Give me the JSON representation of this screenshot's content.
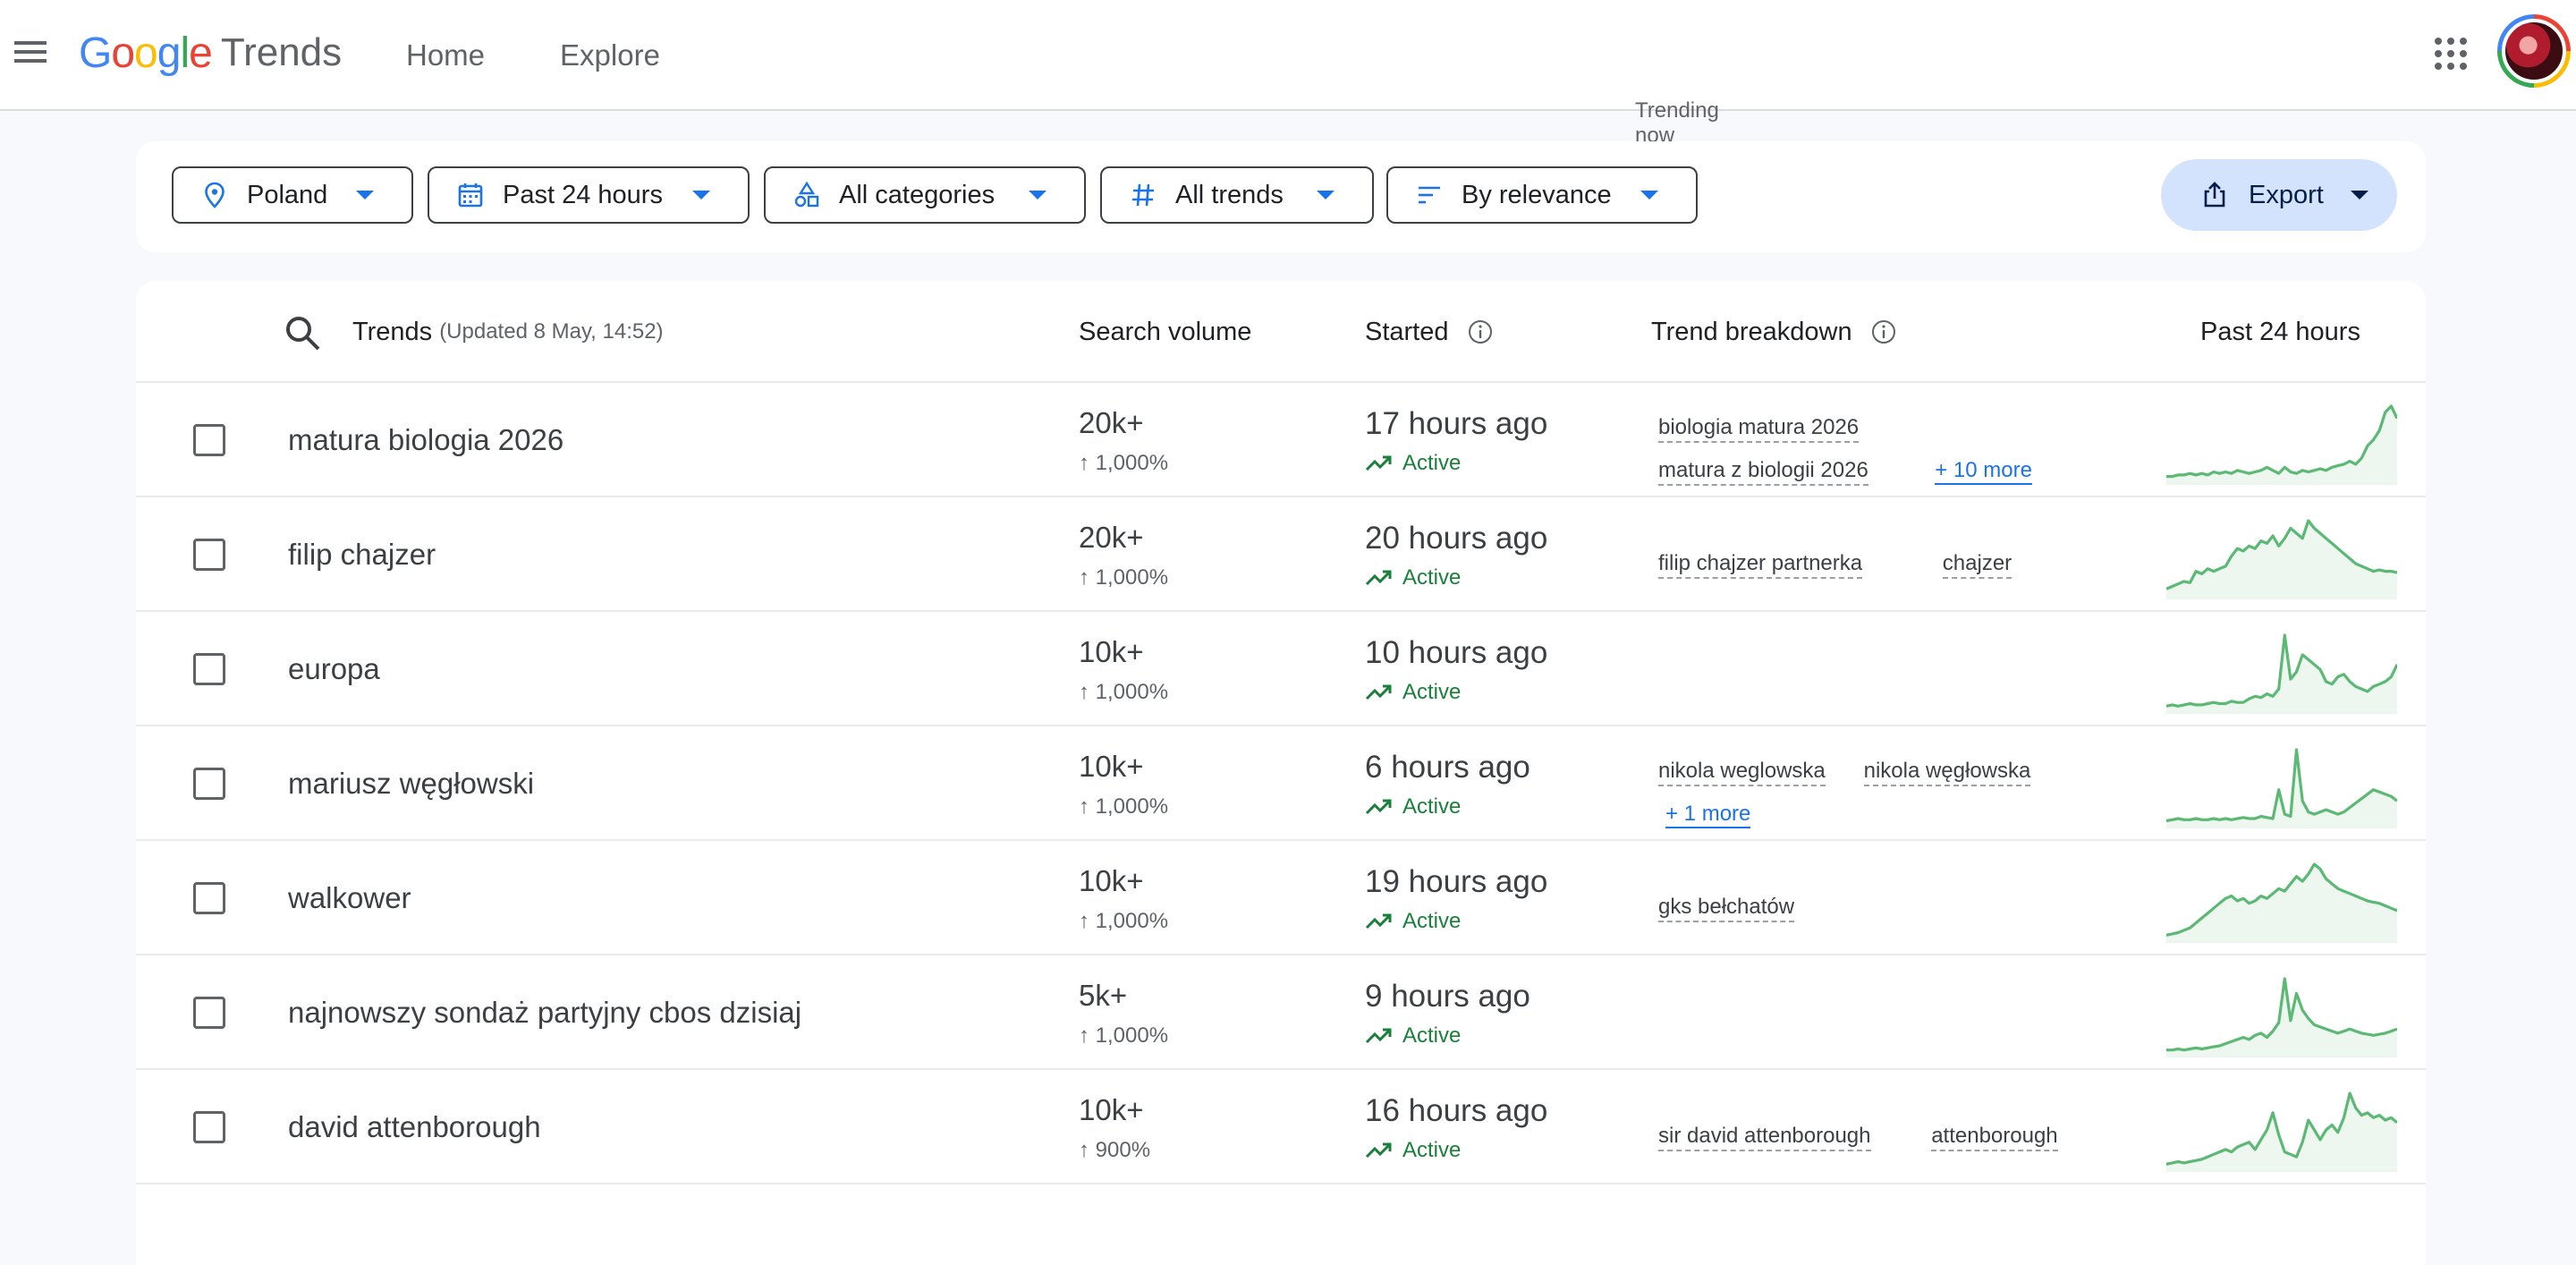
{
  "header": {
    "logo_google": "Google",
    "logo_trends": "Trends",
    "nav": [
      "Home",
      "Explore",
      "Trending now"
    ],
    "active_nav": "Trending now"
  },
  "filters": {
    "country": "Poland",
    "time": "Past 24 hours",
    "categories": "All categories",
    "trends": "All trends",
    "sort": "By relevance",
    "export": "Export"
  },
  "table": {
    "col_trends": "Trends",
    "updated": "(Updated 8 May, 14:52)",
    "col_volume": "Search volume",
    "col_started": "Started",
    "col_breakdown": "Trend breakdown",
    "col_past": "Past 24 hours",
    "rows": [
      {
        "term": "matura biologia 2026",
        "volume": "20k+",
        "change": "↑ 1,000%",
        "started": "17 hours ago",
        "status": "Active",
        "breakdown": [
          "biologia matura 2026",
          "matura z biologii 2026"
        ],
        "more": "+ 10 more",
        "spark": [
          2,
          2,
          3,
          3,
          4,
          3,
          4,
          3,
          5,
          4,
          5,
          4,
          6,
          5,
          4,
          5,
          6,
          8,
          6,
          4,
          8,
          5,
          4,
          6,
          5,
          6,
          7,
          6,
          8,
          9,
          10,
          12,
          10,
          14,
          22,
          26,
          32,
          44,
          48,
          40
        ]
      },
      {
        "term": "filip chajzer",
        "volume": "20k+",
        "change": "↑ 1,000%",
        "started": "20 hours ago",
        "status": "Active",
        "breakdown": [
          "filip chajzer partnerka",
          "chajzer"
        ],
        "more": "",
        "spark": [
          4,
          6,
          8,
          10,
          9,
          18,
          16,
          20,
          18,
          20,
          22,
          30,
          36,
          34,
          38,
          36,
          42,
          40,
          46,
          38,
          44,
          52,
          48,
          44,
          58,
          52,
          48,
          44,
          40,
          36,
          32,
          28,
          24,
          22,
          20,
          18,
          19,
          18,
          18,
          17
        ]
      },
      {
        "term": "europa",
        "volume": "10k+",
        "change": "↑ 1,000%",
        "started": "10 hours ago",
        "status": "Active",
        "breakdown": [],
        "more": "",
        "spark": [
          2,
          3,
          2,
          3,
          4,
          3,
          3,
          4,
          5,
          4,
          4,
          6,
          5,
          5,
          8,
          10,
          9,
          12,
          10,
          16,
          60,
          24,
          30,
          44,
          40,
          36,
          32,
          22,
          20,
          26,
          28,
          22,
          18,
          16,
          14,
          18,
          20,
          22,
          26,
          36
        ]
      },
      {
        "term": "mariusz węgłowski",
        "volume": "10k+",
        "change": "↑ 1,000%",
        "started": "6 hours ago",
        "status": "Active",
        "breakdown": [
          "nikola weglowska",
          "nikola węgłowska"
        ],
        "more": "+ 1 more",
        "spark": [
          2,
          3,
          4,
          3,
          3,
          4,
          3,
          3,
          4,
          3,
          4,
          3,
          4,
          5,
          4,
          4,
          6,
          5,
          4,
          30,
          8,
          6,
          66,
          20,
          10,
          8,
          10,
          12,
          10,
          8,
          10,
          14,
          18,
          22,
          26,
          30,
          28,
          26,
          24,
          20
        ]
      },
      {
        "term": "walkower",
        "volume": "10k+",
        "change": "↑ 1,000%",
        "started": "19 hours ago",
        "status": "Active",
        "breakdown": [
          "gks bełchatów"
        ],
        "more": "",
        "spark": [
          2,
          3,
          4,
          6,
          8,
          12,
          16,
          20,
          24,
          28,
          32,
          34,
          30,
          32,
          28,
          30,
          34,
          32,
          36,
          40,
          38,
          44,
          50,
          46,
          52,
          60,
          56,
          48,
          44,
          40,
          38,
          36,
          34,
          32,
          30,
          29,
          28,
          26,
          24,
          22
        ]
      },
      {
        "term": "najnowszy sondaż partyjny cbos dzisiaj",
        "volume": "5k+",
        "change": "↑ 1,000%",
        "started": "9 hours ago",
        "status": "Active",
        "breakdown": [],
        "more": "",
        "spark": [
          2,
          2,
          3,
          2,
          3,
          4,
          3,
          4,
          5,
          6,
          8,
          10,
          12,
          14,
          12,
          16,
          18,
          14,
          20,
          28,
          70,
          30,
          56,
          40,
          32,
          26,
          24,
          22,
          20,
          18,
          20,
          22,
          20,
          18,
          17,
          16,
          17,
          18,
          20,
          22
        ]
      },
      {
        "term": "david attenborough",
        "volume": "10k+",
        "change": "↑ 900%",
        "started": "16 hours ago",
        "status": "Active",
        "breakdown": [
          "sir david attenborough",
          "attenborough"
        ],
        "more": "",
        "spark": [
          2,
          3,
          4,
          3,
          4,
          5,
          6,
          8,
          10,
          12,
          14,
          12,
          16,
          18,
          20,
          14,
          22,
          30,
          44,
          26,
          12,
          10,
          8,
          20,
          38,
          30,
          22,
          30,
          34,
          28,
          40,
          60,
          48,
          42,
          44,
          40,
          42,
          38,
          40,
          36
        ]
      }
    ]
  }
}
